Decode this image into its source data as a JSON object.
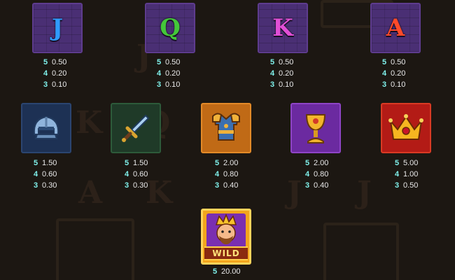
{
  "colors": {
    "multiplier": "#7ff0ea",
    "payout": "#e8e8e8",
    "background": "#1c1712"
  },
  "symbols": [
    {
      "name": "J",
      "icon": "letter-j",
      "color": "#2f9bff",
      "pays": [
        {
          "n": "5",
          "v": "0.50"
        },
        {
          "n": "4",
          "v": "0.20"
        },
        {
          "n": "3",
          "v": "0.10"
        }
      ]
    },
    {
      "name": "Q",
      "icon": "letter-q",
      "color": "#44c63a",
      "pays": [
        {
          "n": "5",
          "v": "0.50"
        },
        {
          "n": "4",
          "v": "0.20"
        },
        {
          "n": "3",
          "v": "0.10"
        }
      ]
    },
    {
      "name": "K",
      "icon": "letter-k",
      "color": "#e04fd6",
      "pays": [
        {
          "n": "5",
          "v": "0.50"
        },
        {
          "n": "4",
          "v": "0.20"
        },
        {
          "n": "3",
          "v": "0.10"
        }
      ]
    },
    {
      "name": "A",
      "icon": "letter-a",
      "color": "#ff4a2a",
      "pays": [
        {
          "n": "5",
          "v": "0.50"
        },
        {
          "n": "4",
          "v": "0.20"
        },
        {
          "n": "3",
          "v": "0.10"
        }
      ]
    },
    {
      "icon": "helmet-icon",
      "pays": [
        {
          "n": "5",
          "v": "1.50"
        },
        {
          "n": "4",
          "v": "0.60"
        },
        {
          "n": "3",
          "v": "0.30"
        }
      ]
    },
    {
      "icon": "sword-icon",
      "pays": [
        {
          "n": "5",
          "v": "1.50"
        },
        {
          "n": "4",
          "v": "0.60"
        },
        {
          "n": "3",
          "v": "0.30"
        }
      ]
    },
    {
      "icon": "armor-icon",
      "pays": [
        {
          "n": "5",
          "v": "2.00"
        },
        {
          "n": "4",
          "v": "0.80"
        },
        {
          "n": "3",
          "v": "0.40"
        }
      ]
    },
    {
      "icon": "goblet-icon",
      "pays": [
        {
          "n": "5",
          "v": "2.00"
        },
        {
          "n": "4",
          "v": "0.80"
        },
        {
          "n": "3",
          "v": "0.40"
        }
      ]
    },
    {
      "icon": "crown-icon",
      "pays": [
        {
          "n": "5",
          "v": "5.00"
        },
        {
          "n": "4",
          "v": "1.00"
        },
        {
          "n": "3",
          "v": "0.50"
        }
      ]
    },
    {
      "icon": "king-wild-icon",
      "label": "WILD",
      "pays": [
        {
          "n": "5",
          "v": "20.00"
        }
      ]
    }
  ]
}
